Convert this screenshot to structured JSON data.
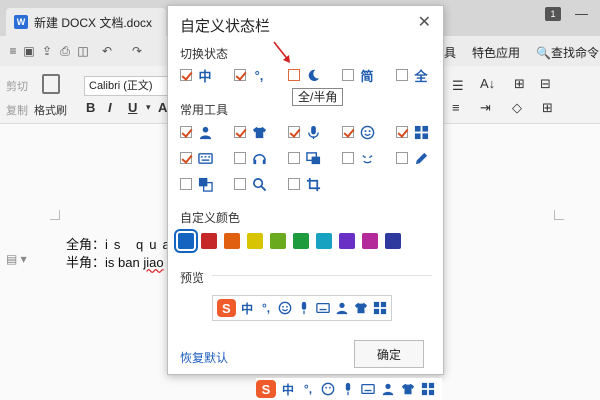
{
  "app": {
    "doc_tab_title": "新建 DOCX 文档.docx",
    "window_count": "1",
    "menu_right": [
      "发工具",
      "特色应用",
      "查找命令"
    ],
    "ribbon": {
      "cut": "剪切",
      "copy": "复制",
      "format_painter": "格式刷",
      "font_name": "Calibri (正文)"
    }
  },
  "document": {
    "line1_label": "全角：",
    "line1_text": "is qua",
    "line2_label": "半角：",
    "line2_text": "is ban ",
    "line2_spell": "jiao"
  },
  "dialog": {
    "title": "自定义状态栏",
    "section_switch": "切换状态",
    "switch_options": [
      {
        "icon": "chinese-mode-icon",
        "glyph": "中",
        "checked": true
      },
      {
        "icon": "punctuation-icon",
        "glyph": "°,",
        "checked": true
      },
      {
        "icon": "half-width-moon-icon",
        "glyph": "",
        "checked": false
      },
      {
        "icon": "simplified-icon",
        "glyph": "简",
        "checked": false
      },
      {
        "icon": "full-width-icon",
        "glyph": "全",
        "checked": false
      }
    ],
    "section_tools": "常用工具",
    "tool_options": [
      {
        "icon": "user-icon",
        "checked": true
      },
      {
        "icon": "tshirt-skin-icon",
        "checked": true
      },
      {
        "icon": "microphone-icon",
        "checked": true
      },
      {
        "icon": "smiley-icon",
        "checked": true
      },
      {
        "icon": "grid-toolbox-icon",
        "checked": true
      },
      {
        "icon": "keyboard-icon",
        "checked": true
      },
      {
        "icon": "headset-icon",
        "checked": false
      },
      {
        "icon": "screen-capture-icon",
        "checked": false
      },
      {
        "icon": "emoji-face-icon",
        "checked": false
      },
      {
        "icon": "pen-icon",
        "checked": false
      },
      {
        "icon": "translate-icon",
        "checked": false
      },
      {
        "icon": "search-icon",
        "checked": false
      },
      {
        "icon": "crop-icon",
        "checked": false
      }
    ],
    "section_color": "自定义颜色",
    "colors": [
      "#1565c0",
      "#c62828",
      "#e06010",
      "#d8c400",
      "#6aaa1e",
      "#1e9b3c",
      "#17a2c2",
      "#6a2fc4",
      "#b52a9a",
      "#2e3a9e"
    ],
    "selected_color_index": 0,
    "section_preview": "预览",
    "restore_default": "恢复默认",
    "ok": "确定",
    "tooltip": "全/半角"
  },
  "preview_bar": {
    "logo": "S",
    "chinese": "中",
    "punct": "°,"
  }
}
